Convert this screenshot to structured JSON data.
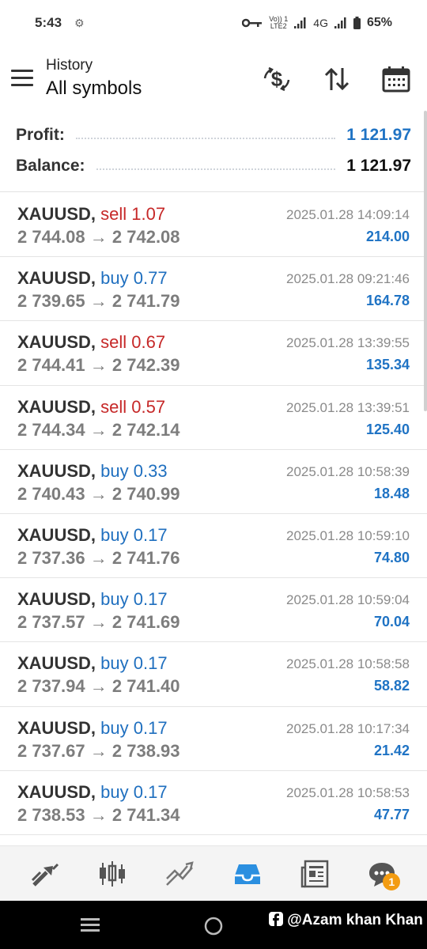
{
  "status": {
    "time": "5:43",
    "network": "4G",
    "battery": "65%",
    "volte_top": "Vo)) 1",
    "volte_bottom": "LTE2"
  },
  "header": {
    "subtitle": "History",
    "title": "All symbols"
  },
  "summary": {
    "profit_label": "Profit:",
    "profit_value": "1 121.97",
    "balance_label": "Balance:",
    "balance_value": "1 121.97"
  },
  "deals": [
    {
      "symbol": "XAUUSD,",
      "side": "sell",
      "volume": "1.07",
      "open": "2 744.08",
      "close": "2 742.08",
      "time": "2025.01.28 14:09:14",
      "profit": "214.00"
    },
    {
      "symbol": "XAUUSD,",
      "side": "buy",
      "volume": "0.77",
      "open": "2 739.65",
      "close": "2 741.79",
      "time": "2025.01.28 09:21:46",
      "profit": "164.78"
    },
    {
      "symbol": "XAUUSD,",
      "side": "sell",
      "volume": "0.67",
      "open": "2 744.41",
      "close": "2 742.39",
      "time": "2025.01.28 13:39:55",
      "profit": "135.34"
    },
    {
      "symbol": "XAUUSD,",
      "side": "sell",
      "volume": "0.57",
      "open": "2 744.34",
      "close": "2 742.14",
      "time": "2025.01.28 13:39:51",
      "profit": "125.40"
    },
    {
      "symbol": "XAUUSD,",
      "side": "buy",
      "volume": "0.33",
      "open": "2 740.43",
      "close": "2 740.99",
      "time": "2025.01.28 10:58:39",
      "profit": "18.48"
    },
    {
      "symbol": "XAUUSD,",
      "side": "buy",
      "volume": "0.17",
      "open": "2 737.36",
      "close": "2 741.76",
      "time": "2025.01.28 10:59:10",
      "profit": "74.80"
    },
    {
      "symbol": "XAUUSD,",
      "side": "buy",
      "volume": "0.17",
      "open": "2 737.57",
      "close": "2 741.69",
      "time": "2025.01.28 10:59:04",
      "profit": "70.04"
    },
    {
      "symbol": "XAUUSD,",
      "side": "buy",
      "volume": "0.17",
      "open": "2 737.94",
      "close": "2 741.40",
      "time": "2025.01.28 10:58:58",
      "profit": "58.82"
    },
    {
      "symbol": "XAUUSD,",
      "side": "buy",
      "volume": "0.17",
      "open": "2 737.67",
      "close": "2 738.93",
      "time": "2025.01.28 10:17:34",
      "profit": "21.42"
    },
    {
      "symbol": "XAUUSD,",
      "side": "buy",
      "volume": "0.17",
      "open": "2 738.53",
      "close": "2 741.34",
      "time": "2025.01.28 10:58:53",
      "profit": "47.77"
    }
  ],
  "arrow": "→",
  "tabs": {
    "chat_badge": "1",
    "active": "history"
  },
  "watermark": "@Azam khan Khan",
  "colors": {
    "sell": "#c62828",
    "buy": "#1f6fbf",
    "profit": "#1f73c4",
    "active_tab": "#2b8fe0"
  }
}
